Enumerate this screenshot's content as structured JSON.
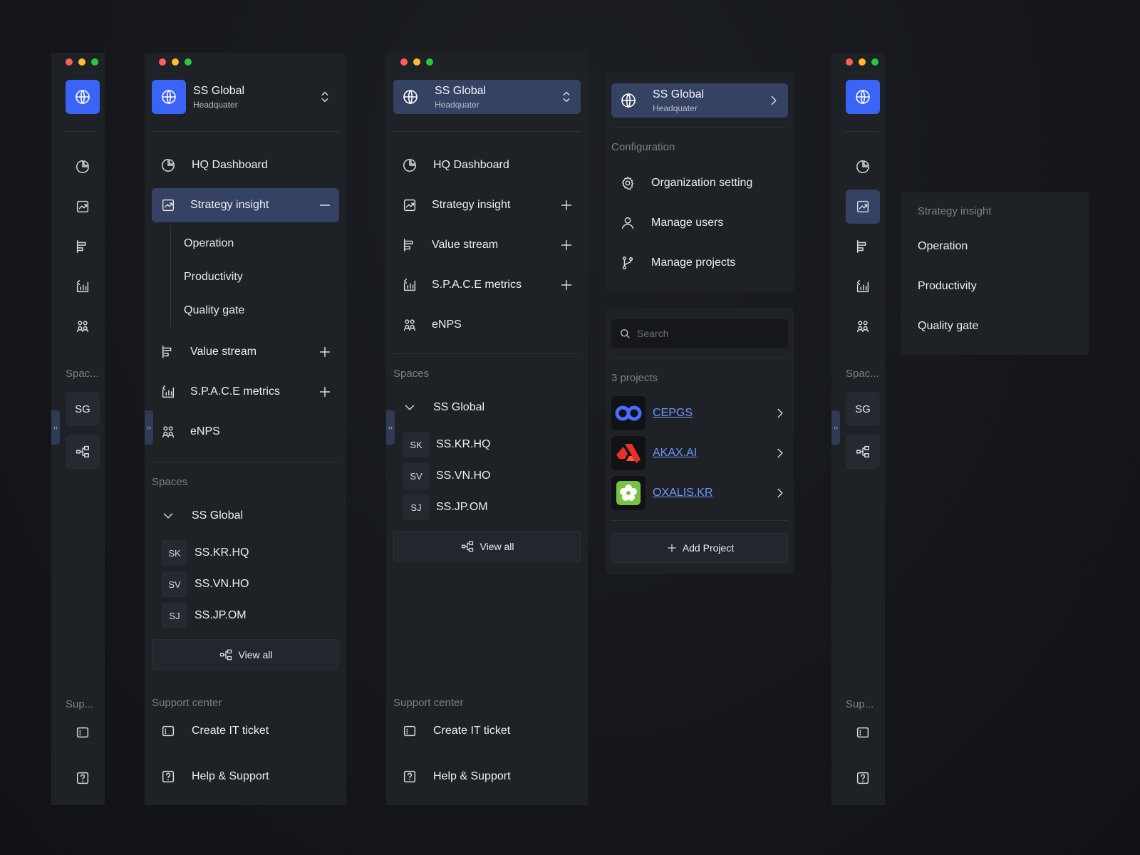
{
  "org": {
    "name": "SS Global",
    "sub": "Headquater"
  },
  "nav": {
    "hq_dashboard": "HQ Dashboard",
    "strategy_insight": "Strategy insight",
    "value_stream": "Value stream",
    "space_metrics": "S.P.A.C.E metrics",
    "enps": "eNPS"
  },
  "strategy_sub": [
    "Operation",
    "Productivity",
    "Quality gate"
  ],
  "spaces": {
    "title": "Spaces",
    "title_short": "Spac...",
    "group": "SS Global",
    "group_abbr": "SG",
    "items": [
      {
        "abbr": "SK",
        "name": "SS.KR.HQ"
      },
      {
        "abbr": "SV",
        "name": "SS.VN.HO"
      },
      {
        "abbr": "SJ",
        "name": "SS.JP.OM"
      }
    ],
    "view_all": "View all"
  },
  "support": {
    "title": "Support center",
    "title_short": "Sup...",
    "create_ticket": "Create IT ticket",
    "help": "Help & Support"
  },
  "config": {
    "title": "Configuration",
    "org_setting": "Organization setting",
    "manage_users": "Manage users",
    "manage_projects": "Manage projects"
  },
  "projects": {
    "search_placeholder": "Search",
    "count_label": "3 projects",
    "items": [
      "CEPGS",
      "AKAX.AI",
      "OXALIS.KR"
    ],
    "add_label": "Add Project"
  },
  "popover": {
    "title": "Strategy insight",
    "items": [
      "Operation",
      "Productivity",
      "Quality gate"
    ]
  },
  "handle_glyph": "‹›",
  "colors": {
    "accent": "#3a64f5",
    "selected": "#364263",
    "link": "#6f96ff",
    "panel": "#1e2126"
  }
}
